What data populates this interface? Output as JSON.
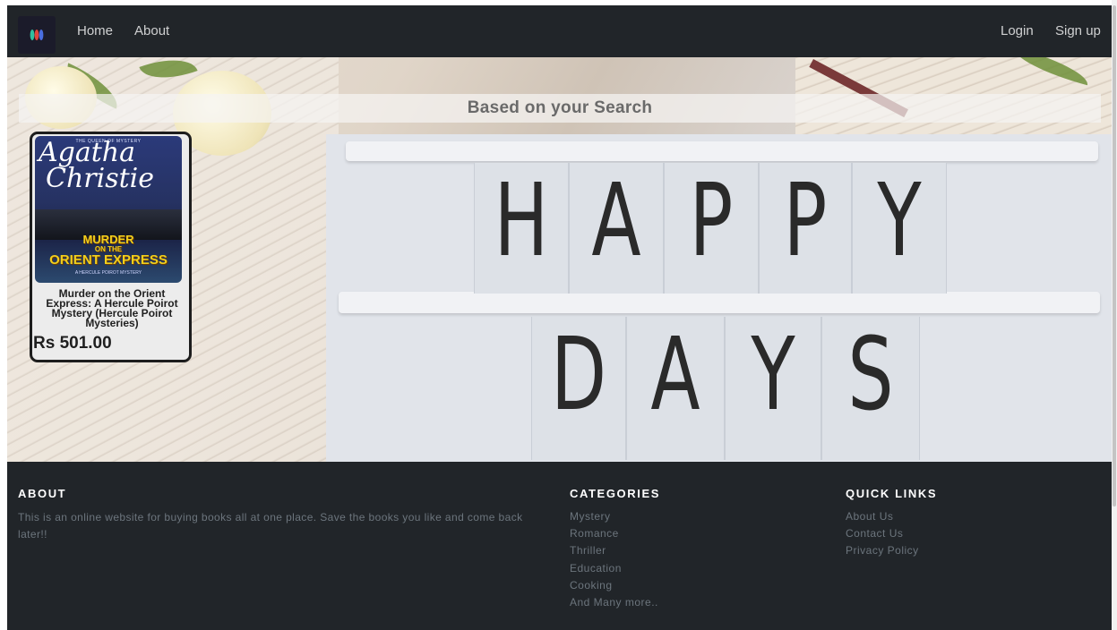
{
  "nav": {
    "home": "Home",
    "about": "About",
    "login": "Login",
    "signup": "Sign up"
  },
  "hero": {
    "search_heading": "Based on your Search",
    "board_top": [
      "H",
      "A",
      "P",
      "P",
      "Y"
    ],
    "board_bottom": [
      "D",
      "A",
      "Y",
      "S"
    ]
  },
  "book": {
    "cover_tag": "THE QUEEN OF MYSTERY",
    "cover_author_line1": "Agatha",
    "cover_author_line2": "Christie",
    "cover_title_line1": "MURDER",
    "cover_title_line2": "ON THE",
    "cover_title_line3": "ORIENT EXPRESS",
    "cover_subtitle": "A HERCULE POIROT MYSTERY",
    "title": "Murder on the Orient Express: A Hercule Poirot Mystery (Hercule Poirot Mysteries)",
    "price": "Rs 501.00"
  },
  "footer": {
    "about_heading": "ABOUT",
    "about_text": "This is an online website for buying books all at one place. Save the books you like and come back later!!",
    "categories_heading": "CATEGORIES",
    "categories": [
      "Mystery",
      "Romance",
      "Thriller",
      "Education",
      "Cooking",
      "And Many more.."
    ],
    "links_heading": "QUICK LINKS",
    "links": [
      "About Us",
      "Contact Us",
      "Privacy Policy"
    ]
  },
  "colors": {
    "navbar": "#212529",
    "footer": "#212529",
    "footer_text": "#6c757d"
  }
}
